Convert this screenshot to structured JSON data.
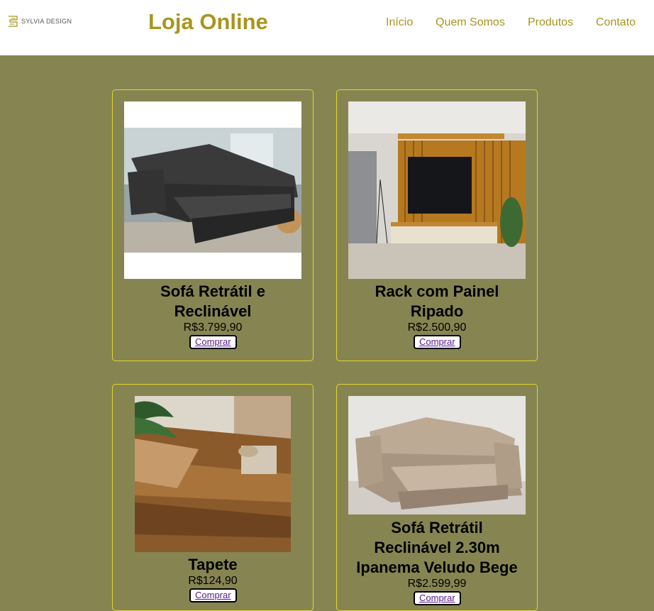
{
  "header": {
    "logo_text": "SYLVIA DESIGN",
    "title": "Loja Online",
    "nav": [
      "Início",
      "Quem Somos",
      "Produtos",
      "Contato"
    ]
  },
  "products": [
    {
      "name_lines": [
        "Sofá Retrátil e",
        "Reclinável"
      ],
      "price": "R$3.799,90",
      "button": "Comprar",
      "image": "gray-sofa-photo"
    },
    {
      "name_lines": [
        "Rack com Painel",
        "Ripado"
      ],
      "price": "R$2.500,90",
      "button": "Comprar",
      "image": "tv-rack-photo"
    },
    {
      "name_lines": [
        "Tapete"
      ],
      "price": "R$124,90",
      "button": "Comprar",
      "image": "rug-photo"
    },
    {
      "name_lines": [
        "Sofá Retrátil",
        "Reclinável 2.30m",
        "Ipanema Veludo Bege"
      ],
      "price": "R$2.599,99",
      "button": "Comprar",
      "image": "beige-sofa-photo"
    }
  ],
  "colors": {
    "background": "#868552",
    "brand": "#a8951f",
    "card_border": "#e1d62a"
  }
}
